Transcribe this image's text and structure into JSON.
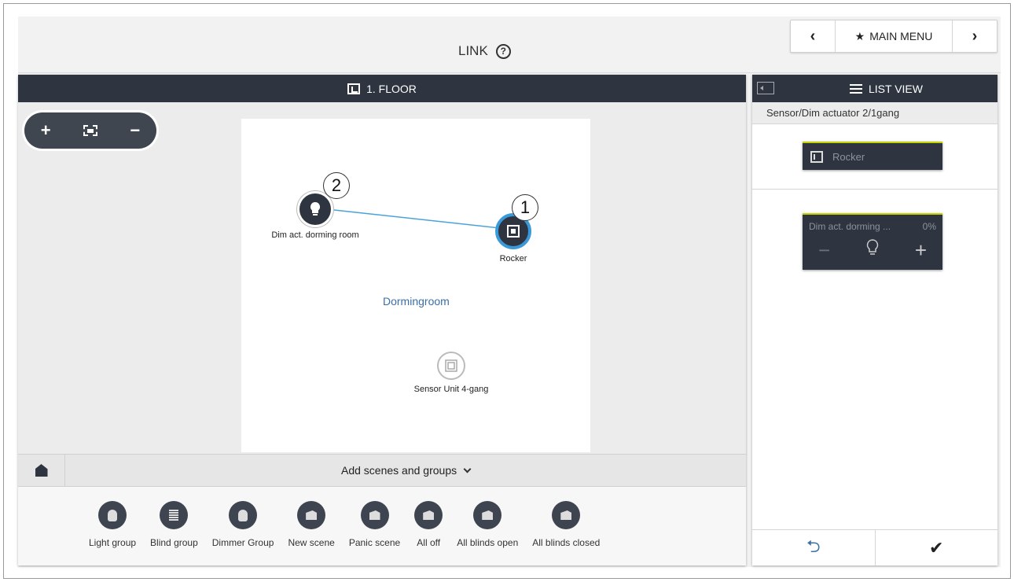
{
  "header": {
    "title": "LINK",
    "help_icon": "?",
    "nav": {
      "prev": "‹",
      "main_menu": "MAIN MENU",
      "next": "›"
    }
  },
  "floor": {
    "title": "1. FLOOR",
    "zoom": {
      "plus": "+",
      "minus": "−"
    },
    "devices": [
      {
        "label": "Dim act. dorming room",
        "callout": "2"
      },
      {
        "label": "Rocker",
        "callout": "1"
      },
      {
        "label": "Sensor Unit 4-gang"
      }
    ],
    "room": "Dormingroom"
  },
  "scenes": {
    "toggle": "Add scenes and groups",
    "items": [
      {
        "label": "Light group",
        "icon": "bulb"
      },
      {
        "label": "Blind group",
        "icon": "blind"
      },
      {
        "label": "Dimmer Group",
        "icon": "bulb"
      },
      {
        "label": "New scene",
        "icon": "clapper"
      },
      {
        "label": "Panic scene",
        "icon": "clapper"
      },
      {
        "label": "All off",
        "icon": "clapper"
      },
      {
        "label": "All blinds open",
        "icon": "clapper"
      },
      {
        "label": "All blinds closed",
        "icon": "clapper"
      }
    ]
  },
  "list": {
    "title": "LIST VIEW",
    "device_title": "Sensor/Dim actuator 2/1gang",
    "rocker": "Rocker",
    "dim": {
      "name": "Dim act. dorming ...",
      "percent": "0%",
      "minus": "−",
      "plus": "+"
    },
    "footer": {
      "back": "⮌",
      "confirm": "✔"
    }
  },
  "colors": {
    "header_bg": "#2e3540",
    "link_line": "#4aa3d8",
    "accent": "#c8d400"
  }
}
